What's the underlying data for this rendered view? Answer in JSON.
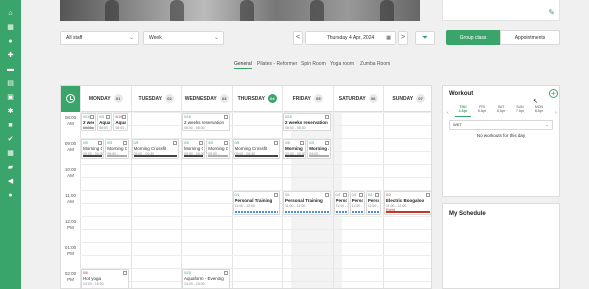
{
  "sidebar": {
    "icons": [
      "home-icon",
      "dashboard-icon",
      "user-icon",
      "user-add-icon",
      "card-icon",
      "document-icon",
      "calendar-icon",
      "team-icon",
      "video-icon",
      "checkin-icon",
      "calendar-grid-icon",
      "store-icon",
      "megaphone-icon",
      "chat-icon"
    ],
    "glyphs": [
      "⌂",
      "▦",
      "●",
      "✚",
      "▬",
      "▤",
      "▣",
      "✱",
      "■",
      "✔",
      "▦",
      "▰",
      "◀",
      "●"
    ],
    "accent": "#3aa56b"
  },
  "filters": {
    "staff_value": "All staff",
    "view_value": "Week",
    "prev_label": "<",
    "next_label": ">",
    "date_value": "Thursday 4 Apr, 2024",
    "group_class_label": "Group class",
    "appointments_label": "Appointments"
  },
  "tabs": [
    "General",
    "Pilates - Reformer",
    "Spin Room",
    "Yoga room",
    "Zumba Room"
  ],
  "calendar": {
    "days": [
      {
        "name": "MONDAY",
        "num": "01",
        "today": false
      },
      {
        "name": "TUESDAY",
        "num": "02",
        "today": false
      },
      {
        "name": "WEDNESDAY",
        "num": "03",
        "today": false
      },
      {
        "name": "THURSDAY",
        "num": "04",
        "today": true
      },
      {
        "name": "FRIDAY",
        "num": "05",
        "today": false
      },
      {
        "name": "SATURDAY",
        "num": "06",
        "today": false
      },
      {
        "name": "SUNDAY",
        "num": "07",
        "today": false
      }
    ],
    "times": [
      {
        "h": "08:00",
        "p": "AM"
      },
      {
        "h": "09:00",
        "p": "AM"
      },
      {
        "h": "10:00",
        "p": "AM"
      },
      {
        "h": "11:00",
        "p": "AM"
      },
      {
        "h": "12:00",
        "p": "PM"
      },
      {
        "h": "01:00",
        "p": "PM"
      },
      {
        "h": "02:00",
        "p": "PM"
      }
    ],
    "events": [
      {
        "day": 0,
        "slot": 0.0,
        "dur": 0.75,
        "sub": 0,
        "subs": 3,
        "count": "0/16",
        "title": "2 weeks...",
        "time": "08:00 - 08:30",
        "bar": "gray",
        "red": false,
        "bold": true
      },
      {
        "day": 0,
        "slot": 0.0,
        "dur": 0.75,
        "sub": 1,
        "subs": 3,
        "count": "0/5",
        "title": "Aqua...",
        "time": "08:00 -",
        "bar": "",
        "red": false,
        "bold": true
      },
      {
        "day": 0,
        "slot": 0.0,
        "dur": 0.75,
        "sub": 2,
        "subs": 3,
        "count": "5/15",
        "title": "Aqua...",
        "time": "08:00 -",
        "bar": "",
        "red": true,
        "bold": true
      },
      {
        "day": 2,
        "slot": 0.0,
        "dur": 0.75,
        "sub": 0,
        "subs": 1,
        "count": "0/15",
        "title": "2 weeks reservation",
        "time": "08:00 - 08:30",
        "bar": "",
        "red": false,
        "bold": false
      },
      {
        "day": 4,
        "slot": 0.0,
        "dur": 0.75,
        "sub": 0,
        "subs": 1,
        "count": "0/15",
        "title": "2 weeks reservation",
        "time": "08:00 - 08:30",
        "bar": "",
        "red": false,
        "bold": true
      },
      {
        "day": 0,
        "slot": 1.0,
        "dur": 0.85,
        "sub": 0,
        "subs": 2,
        "count": "0/5",
        "title": "Morning C...",
        "time": "09:00 - 09:30",
        "bar": "dark",
        "red": false,
        "bold": false
      },
      {
        "day": 0,
        "slot": 1.0,
        "dur": 0.85,
        "sub": 1,
        "subs": 2,
        "count": "0/5",
        "title": "Morning C...",
        "time": "09:00 -",
        "bar": "gray",
        "red": false,
        "bold": false
      },
      {
        "day": 1,
        "slot": 1.0,
        "dur": 0.85,
        "sub": 0,
        "subs": 1,
        "count": "0/5",
        "title": "Morning Crossfit",
        "time": "09:00 - 09:30",
        "bar": "dark",
        "red": false,
        "bold": false
      },
      {
        "day": 2,
        "slot": 1.0,
        "dur": 0.85,
        "sub": 0,
        "subs": 2,
        "count": "0/5",
        "title": "Morning C...",
        "time": "09:00 - 09:30",
        "bar": "dark",
        "red": false,
        "bold": false
      },
      {
        "day": 2,
        "slot": 1.0,
        "dur": 0.85,
        "sub": 1,
        "subs": 2,
        "count": "0/5",
        "title": "Morning C...",
        "time": "09:00 -",
        "bar": "gray",
        "red": false,
        "bold": false
      },
      {
        "day": 3,
        "slot": 1.0,
        "dur": 0.85,
        "sub": 0,
        "subs": 1,
        "count": "0/5",
        "title": "Morning Crossfit",
        "time": "09:00 - 09:30",
        "bar": "dark",
        "red": false,
        "bold": false
      },
      {
        "day": 4,
        "slot": 1.0,
        "dur": 0.85,
        "sub": 0,
        "subs": 2,
        "count": "0/5",
        "title": "Morning C...",
        "time": "09:00 - 09:30",
        "bar": "dark",
        "red": false,
        "bold": true
      },
      {
        "day": 4,
        "slot": 1.0,
        "dur": 0.85,
        "sub": 1,
        "subs": 2,
        "count": "0/5",
        "title": "Morning ...",
        "time": "09:00 -",
        "bar": "gray",
        "red": false,
        "bold": true
      },
      {
        "day": 3,
        "slot": 3.0,
        "dur": 1.0,
        "sub": 0,
        "subs": 1,
        "count": "0/1",
        "title": "Personal Training",
        "time": "11:00 - 12:00",
        "bar": "blue",
        "red": false,
        "bold": true
      },
      {
        "day": 4,
        "slot": 3.0,
        "dur": 1.0,
        "sub": 0,
        "subs": 1,
        "count": "0/1",
        "title": "Personal Training",
        "time": "11:00 - 12:00",
        "bar": "blue",
        "red": false,
        "bold": true
      },
      {
        "day": 5,
        "slot": 3.0,
        "dur": 1.0,
        "sub": 0,
        "subs": 3,
        "count": "0/1",
        "title": "Perso...",
        "time": "11:00 - 12:00",
        "bar": "blue",
        "red": false,
        "bold": true
      },
      {
        "day": 5,
        "slot": 3.0,
        "dur": 1.0,
        "sub": 1,
        "subs": 3,
        "count": "0/1",
        "title": "Perso...",
        "time": "11:00 -",
        "bar": "blue",
        "red": false,
        "bold": true
      },
      {
        "day": 5,
        "slot": 3.0,
        "dur": 1.0,
        "sub": 2,
        "subs": 3,
        "count": "0/1",
        "title": "Perso...",
        "time": "11:00 -",
        "bar": "blue",
        "red": false,
        "bold": true
      },
      {
        "day": 6,
        "slot": 3.0,
        "dur": 1.0,
        "sub": 0,
        "subs": 1,
        "count": "0/2",
        "title": "Electric Boogaloo",
        "time": "11:00 - 12:00",
        "bar": "red",
        "red": true,
        "bold": true,
        "tag": "Event"
      },
      {
        "day": 0,
        "slot": 6.0,
        "dur": 1.0,
        "sub": 0,
        "subs": 1,
        "count": "5/6",
        "title": "Hot yoga",
        "time": "14:00 - 15:00",
        "bar": "",
        "red": true,
        "bold": false
      },
      {
        "day": 2,
        "slot": 6.0,
        "dur": 1.0,
        "sub": 0,
        "subs": 1,
        "count": "0/15",
        "title": "Aquaform - Evening",
        "time": "14:00 - 15:00",
        "bar": "",
        "red": false,
        "bold": false
      }
    ]
  },
  "workout": {
    "title": "Workout",
    "week": [
      {
        "d": "THU",
        "n": "4 Apr",
        "active": true
      },
      {
        "d": "FRI",
        "n": "5 Apr",
        "active": false
      },
      {
        "d": "SAT",
        "n": "6 Apr",
        "active": false
      },
      {
        "d": "SUN",
        "n": "7 Apr",
        "active": false
      },
      {
        "d": "MON",
        "n": "8 Apr",
        "active": false
      }
    ],
    "dropdown_value": "WKT",
    "empty_text": "No workouts for this day"
  },
  "schedule": {
    "title": "My Schedule"
  }
}
